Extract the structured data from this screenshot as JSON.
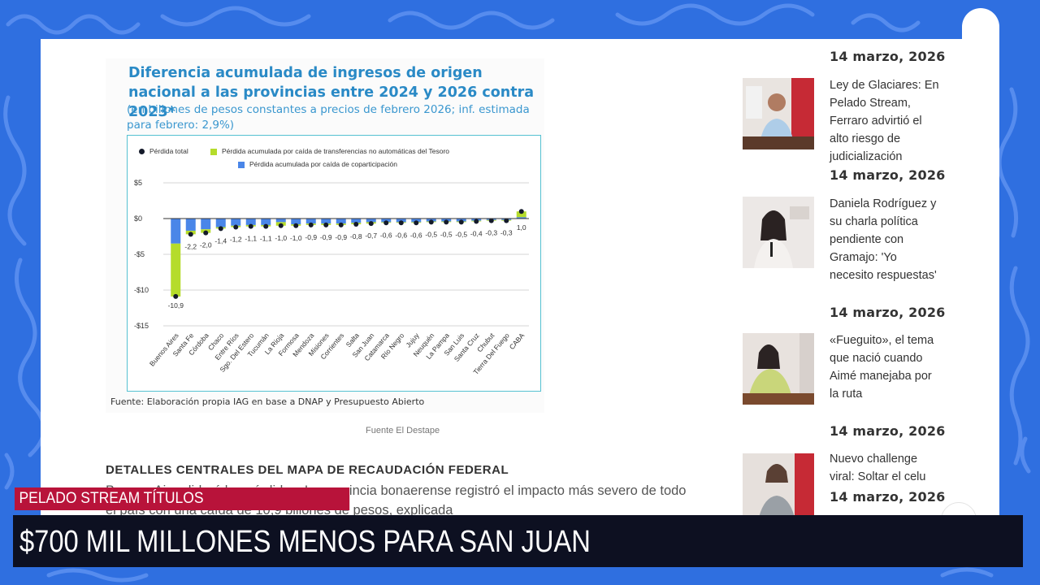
{
  "figure": {
    "title": "Diferencia acumulada de ingresos de origen nacional a las provincias entre 2024 y 2026 contra 2023*",
    "subtitle": "(en billones de pesos constantes a precios de febrero 2026; inf. estimada para febrero: 2,9%)",
    "source": "Fuente: Elaboración propia IAG en base a DNAP y Presupuesto Abierto",
    "caption": "Fuente El Destape"
  },
  "chart_data": {
    "type": "bar",
    "legend": {
      "total": "Pérdida total",
      "transfers": "Pérdida acumulada por caída de transferencias no automáticas del Tesoro",
      "copart": "Pérdida acumulada por caída de coparticipación"
    },
    "colors": {
      "copart": "#4a86e8",
      "transfers": "#b5dc2b",
      "total": "#141a2a"
    },
    "yticks": [
      "$5",
      "$0",
      "-$5",
      "-$10",
      "-$15"
    ],
    "ylim": [
      -15,
      5
    ],
    "categories": [
      "Buenos Aires",
      "Santa Fe",
      "Córdoba",
      "Chaco",
      "Entre Ríos",
      "Sgo. Del Estero",
      "Tucumán",
      "La Rioja",
      "Formosa",
      "Mendoza",
      "Misiones",
      "Corrientes",
      "Salta",
      "San Juan",
      "Catamarca",
      "Río Negro",
      "Jujuy",
      "Neuquén",
      "La Pampa",
      "San Luis",
      "Santa Cruz",
      "Chubut",
      "Tierra Del Fuego",
      "CABA"
    ],
    "total_labels": [
      "-10,9",
      "-2,2",
      "-2,0",
      "-1,4",
      "-1,2",
      "-1,1",
      "-1,1",
      "-1,0",
      "-1,0",
      "-0,9",
      "-0,9",
      "-0,9",
      "-0,8",
      "-0,7",
      "-0,6",
      "-0,6",
      "-0,6",
      "-0,5",
      "-0,5",
      "-0,5",
      "-0,4",
      "-0,3",
      "-0,3",
      "1,0"
    ],
    "total": [
      -10.9,
      -2.2,
      -2.0,
      -1.4,
      -1.2,
      -1.1,
      -1.1,
      -1.0,
      -1.0,
      -0.9,
      -0.9,
      -0.9,
      -0.8,
      -0.7,
      -0.6,
      -0.6,
      -0.6,
      -0.5,
      -0.5,
      -0.5,
      -0.4,
      -0.3,
      -0.3,
      1.0
    ],
    "series": [
      {
        "name": "Pérdida acumulada por caída de coparticipación",
        "values": [
          -3.5,
          -1.7,
          -1.5,
          -1.2,
          -1.0,
          -0.9,
          -0.9,
          -0.5,
          -0.8,
          -0.7,
          -0.7,
          -0.7,
          -0.6,
          -0.5,
          -0.5,
          -0.5,
          -0.5,
          -0.4,
          -0.4,
          -0.4,
          -0.3,
          -0.2,
          -0.2,
          0.2
        ]
      },
      {
        "name": "Pérdida acumulada por caída de transferencias no automáticas del Tesoro",
        "values": [
          -7.4,
          -0.5,
          -0.5,
          -0.2,
          -0.2,
          -0.2,
          -0.2,
          -0.5,
          -0.2,
          -0.2,
          -0.2,
          -0.2,
          -0.2,
          -0.2,
          -0.1,
          -0.1,
          -0.1,
          -0.1,
          -0.1,
          -0.1,
          -0.1,
          -0.1,
          -0.1,
          0.8
        ]
      }
    ]
  },
  "article": {
    "section_heading": "DETALLES CENTRALES DEL MAPA DE RECAUDACIÓN FEDERAL",
    "body": "Buenos Aires lideró las pérdidas: La provincia bonaerense registró el impacto más severo de todo el país con una caída de 10,9 billones de pesos, explicada"
  },
  "sidebar": {
    "top_date": "14 marzo, 2026",
    "items": [
      {
        "title": "Ley de Glaciares: En Pelado Stream, Ferraro advirtió el alto riesgo de judicialización",
        "date": "14 marzo, 2026"
      },
      {
        "title": "Daniela Rodríguez y su charla política pendiente con Gramajo: 'Yo necesito respuestas'",
        "date": "14 marzo, 2026"
      },
      {
        "title": "«Fueguito», el tema que nació cuando Aimé manejaba por la ruta",
        "date": "14 marzo, 2026"
      },
      {
        "title": "Nuevo challenge viral: Soltar el celu",
        "date": "14 marzo, 2026"
      }
    ]
  },
  "overlay": {
    "label": "PELADO STREAM TÍTULOS",
    "headline": "$700 MIL MILLONES MENOS PARA SAN JUAN"
  }
}
